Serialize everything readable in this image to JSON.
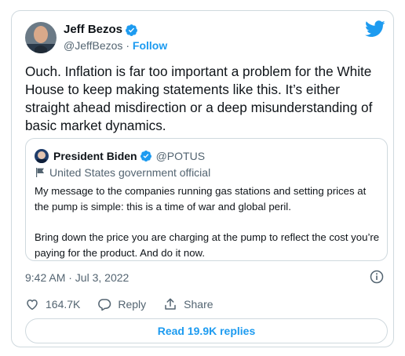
{
  "author": {
    "name": "Jeff Bezos",
    "handle": "@JeffBezos",
    "separator": "·",
    "follow_label": "Follow"
  },
  "tweet": {
    "text": "Ouch. Inflation is far too important a problem for the White House to keep making statements like this. It’s either straight ahead misdirection or a deep misunderstanding of basic market dynamics."
  },
  "quote": {
    "name": "President Biden",
    "handle": "@POTUS",
    "label": "United States government official",
    "paragraph1": "My message to the companies running gas stations and setting prices at the pump is simple: this is a time of war and global peril.",
    "paragraph2": "Bring down the price you are charging at the pump to reflect the cost you’re paying for the product. And do it now."
  },
  "meta": {
    "timestamp": "9:42 AM · Jul 3, 2022"
  },
  "actions": {
    "likes": "164.7K",
    "reply_label": "Reply",
    "share_label": "Share"
  },
  "replies_button": {
    "label": "Read 19.9K replies"
  },
  "colors": {
    "accent": "#1d9bf0",
    "secondary_text": "#536471",
    "border": "#cfd9de"
  },
  "icons": [
    "verified-badge-icon",
    "twitter-bird-icon",
    "flag-icon",
    "info-icon",
    "heart-icon",
    "reply-icon",
    "share-icon"
  ]
}
